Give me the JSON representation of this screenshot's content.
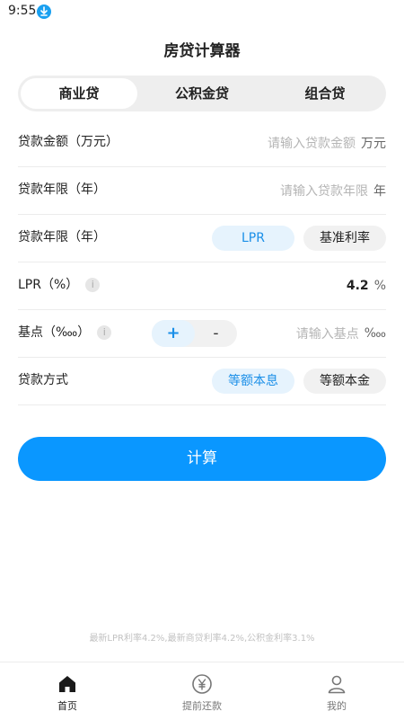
{
  "status_bar": {
    "time": "9:55"
  },
  "header": {
    "title": "房贷计算器"
  },
  "tabs": [
    {
      "label": "商业贷",
      "active": true
    },
    {
      "label": "公积金贷",
      "active": false
    },
    {
      "label": "组合贷",
      "active": false
    }
  ],
  "form": {
    "loan_amount": {
      "label": "贷款金额（万元）",
      "placeholder": "请输入贷款金额",
      "unit": "万元"
    },
    "loan_years": {
      "label": "贷款年限（年）",
      "placeholder": "请输入贷款年限",
      "unit": "年"
    },
    "rate_type": {
      "label": "贷款年限（年）",
      "options": [
        "LPR",
        "基准利率"
      ],
      "selected": "LPR"
    },
    "lpr": {
      "label": "LPR（%）",
      "value": "4.2",
      "unit": "%"
    },
    "basis_point": {
      "label": "基点（‱）",
      "plus": "+",
      "minus": "-",
      "placeholder": "请输入基点",
      "unit": "‱"
    },
    "repay_method": {
      "label": "贷款方式",
      "options": [
        "等额本息",
        "等额本金"
      ],
      "selected": "等额本息"
    }
  },
  "calc_button": "计算",
  "footnote": "最新LPR利率4.2%,最新商贷利率4.2%,公积金利率3.1%",
  "bottom_nav": [
    {
      "label": "首页",
      "icon": "home-icon",
      "active": true
    },
    {
      "label": "提前还款",
      "icon": "yuan-coin-icon",
      "active": false
    },
    {
      "label": "我的",
      "icon": "user-icon",
      "active": false
    }
  ],
  "colors": {
    "accent": "#0a97ff",
    "accent_light": "#e6f3fd",
    "placeholder": "#b5b5b5"
  }
}
